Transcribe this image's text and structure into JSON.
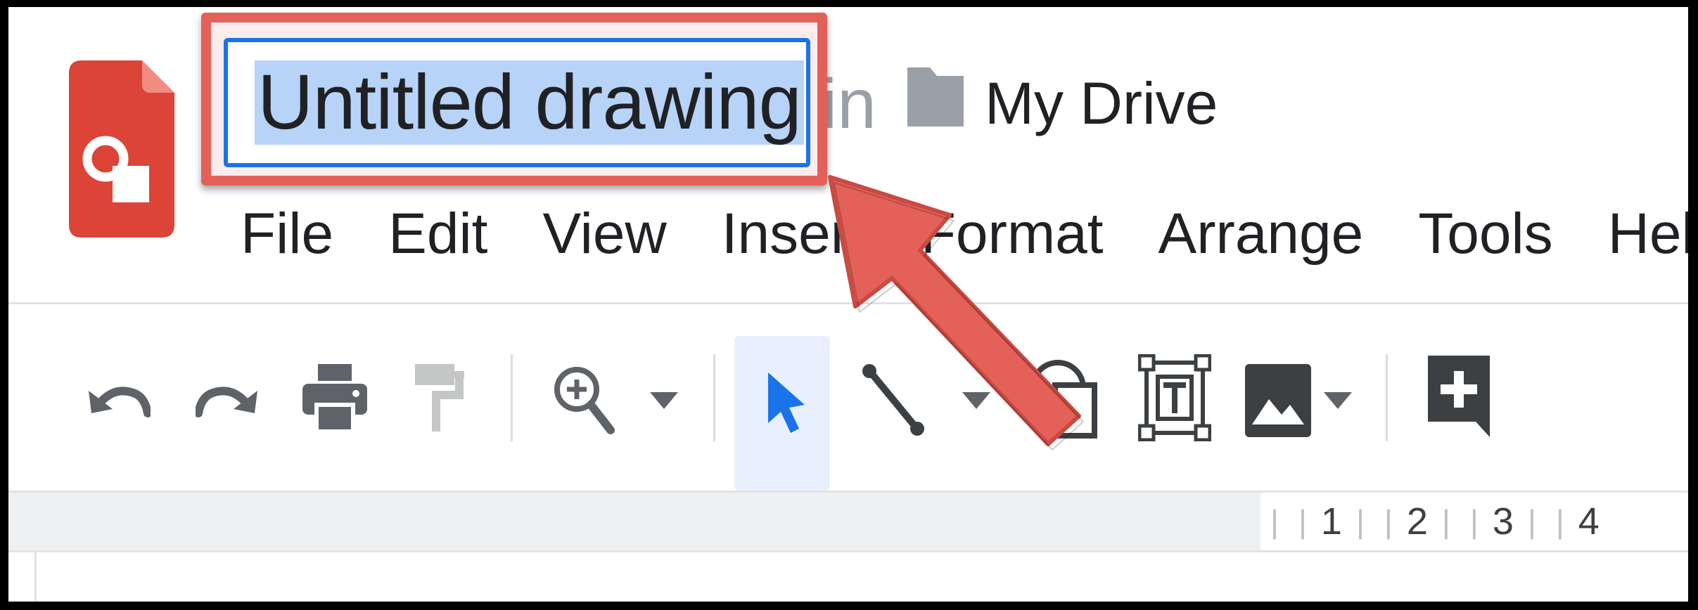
{
  "document": {
    "title": "Untitled drawing",
    "location_prefix": "in",
    "location_folder": "My Drive"
  },
  "menu": [
    "File",
    "Edit",
    "View",
    "Insert",
    "Format",
    "Arrange",
    "Tools",
    "Help"
  ],
  "toolbar": {
    "items": [
      "undo-icon",
      "redo-icon",
      "print-icon",
      "paint-format-icon",
      "zoom-icon",
      "select-icon",
      "line-icon",
      "shape-icon",
      "text-box-icon",
      "image-icon",
      "comment-icon"
    ]
  },
  "ruler": {
    "labels": [
      "1",
      "2",
      "3",
      "4"
    ]
  },
  "colors": {
    "app_red": "#db4437",
    "highlight_red": "#e4615a",
    "focus_blue": "#1a73e8",
    "selection_blue": "#b7d3f7"
  }
}
